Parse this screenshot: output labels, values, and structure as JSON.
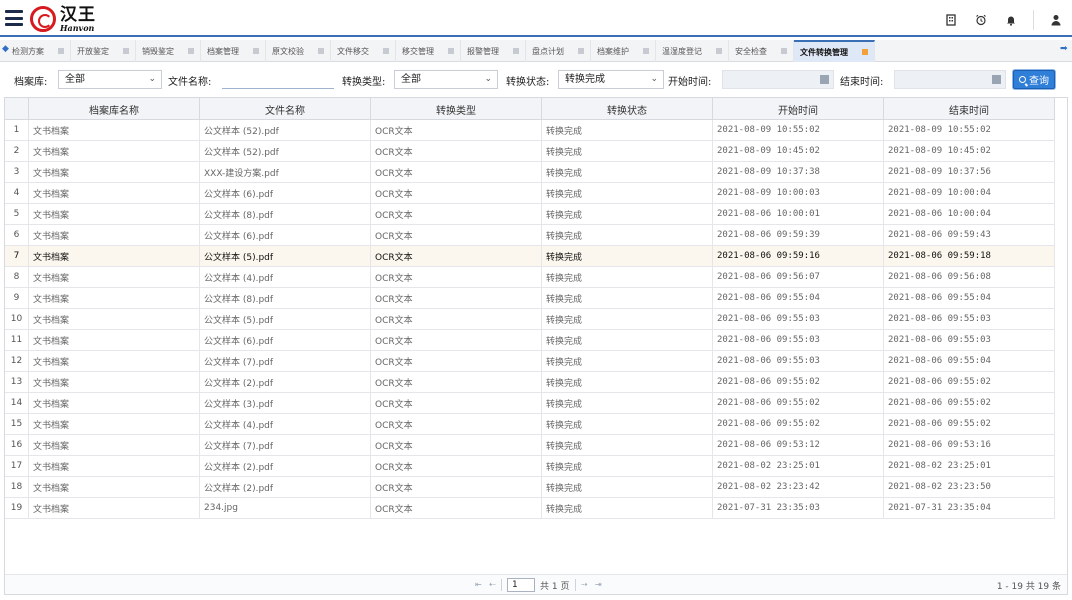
{
  "header": {
    "logo_cn": "汉王",
    "logo_en": "Hanvon"
  },
  "tabs": [
    {
      "label": "检测方案"
    },
    {
      "label": "开放鉴定"
    },
    {
      "label": "销毁鉴定"
    },
    {
      "label": "档案管理"
    },
    {
      "label": "原文校验"
    },
    {
      "label": "文件移交"
    },
    {
      "label": "移交管理"
    },
    {
      "label": "报警管理"
    },
    {
      "label": "盘点计划"
    },
    {
      "label": "档案维护"
    },
    {
      "label": "温湿度登记"
    },
    {
      "label": "安全检查"
    },
    {
      "label": "文件转换管理",
      "active": true
    }
  ],
  "filters": {
    "archive_label": "档案库:",
    "archive_value": "全部",
    "filename_label": "文件名称:",
    "type_label": "转换类型:",
    "type_value": "全部",
    "status_label": "转换状态:",
    "status_value": "转换完成",
    "start_label": "开始时间:",
    "end_label": "结束时间:",
    "search_label": "查询"
  },
  "table": {
    "columns": [
      "档案库名称",
      "文件名称",
      "转换类型",
      "转换状态",
      "开始时间",
      "结束时间"
    ],
    "rows": [
      {
        "n": "1",
        "lib": "文书档案",
        "file": "公文样本 (52).pdf",
        "type": "OCR文本",
        "status": "转换完成",
        "start": "2021-08-09 10:55:02",
        "end": "2021-08-09 10:55:02"
      },
      {
        "n": "2",
        "lib": "文书档案",
        "file": "公文样本 (52).pdf",
        "type": "OCR文本",
        "status": "转换完成",
        "start": "2021-08-09 10:45:02",
        "end": "2021-08-09 10:45:02"
      },
      {
        "n": "3",
        "lib": "文书档案",
        "file": "XXX-建设方案.pdf",
        "type": "OCR文本",
        "status": "转换完成",
        "start": "2021-08-09 10:37:38",
        "end": "2021-08-09 10:37:56"
      },
      {
        "n": "4",
        "lib": "文书档案",
        "file": "公文样本 (6).pdf",
        "type": "OCR文本",
        "status": "转换完成",
        "start": "2021-08-09 10:00:03",
        "end": "2021-08-09 10:00:04"
      },
      {
        "n": "5",
        "lib": "文书档案",
        "file": "公文样本 (8).pdf",
        "type": "OCR文本",
        "status": "转换完成",
        "start": "2021-08-06 10:00:01",
        "end": "2021-08-06 10:00:04"
      },
      {
        "n": "6",
        "lib": "文书档案",
        "file": "公文样本 (6).pdf",
        "type": "OCR文本",
        "status": "转换完成",
        "start": "2021-08-06 09:59:39",
        "end": "2021-08-06 09:59:43"
      },
      {
        "n": "7",
        "lib": "文书档案",
        "file": "公文样本 (5).pdf",
        "type": "OCR文本",
        "status": "转换完成",
        "start": "2021-08-06 09:59:16",
        "end": "2021-08-06 09:59:18",
        "selected": true
      },
      {
        "n": "8",
        "lib": "文书档案",
        "file": "公文样本 (4).pdf",
        "type": "OCR文本",
        "status": "转换完成",
        "start": "2021-08-06 09:56:07",
        "end": "2021-08-06 09:56:08"
      },
      {
        "n": "9",
        "lib": "文书档案",
        "file": "公文样本 (8).pdf",
        "type": "OCR文本",
        "status": "转换完成",
        "start": "2021-08-06 09:55:04",
        "end": "2021-08-06 09:55:04"
      },
      {
        "n": "10",
        "lib": "文书档案",
        "file": "公文样本 (5).pdf",
        "type": "OCR文本",
        "status": "转换完成",
        "start": "2021-08-06 09:55:03",
        "end": "2021-08-06 09:55:03"
      },
      {
        "n": "11",
        "lib": "文书档案",
        "file": "公文样本 (6).pdf",
        "type": "OCR文本",
        "status": "转换完成",
        "start": "2021-08-06 09:55:03",
        "end": "2021-08-06 09:55:03"
      },
      {
        "n": "12",
        "lib": "文书档案",
        "file": "公文样本 (7).pdf",
        "type": "OCR文本",
        "status": "转换完成",
        "start": "2021-08-06 09:55:03",
        "end": "2021-08-06 09:55:04"
      },
      {
        "n": "13",
        "lib": "文书档案",
        "file": "公文样本 (2).pdf",
        "type": "OCR文本",
        "status": "转换完成",
        "start": "2021-08-06 09:55:02",
        "end": "2021-08-06 09:55:02"
      },
      {
        "n": "14",
        "lib": "文书档案",
        "file": "公文样本 (3).pdf",
        "type": "OCR文本",
        "status": "转换完成",
        "start": "2021-08-06 09:55:02",
        "end": "2021-08-06 09:55:02"
      },
      {
        "n": "15",
        "lib": "文书档案",
        "file": "公文样本 (4).pdf",
        "type": "OCR文本",
        "status": "转换完成",
        "start": "2021-08-06 09:55:02",
        "end": "2021-08-06 09:55:02"
      },
      {
        "n": "16",
        "lib": "文书档案",
        "file": "公文样本 (7).pdf",
        "type": "OCR文本",
        "status": "转换完成",
        "start": "2021-08-06 09:53:12",
        "end": "2021-08-06 09:53:16"
      },
      {
        "n": "17",
        "lib": "文书档案",
        "file": "公文样本 (2).pdf",
        "type": "OCR文本",
        "status": "转换完成",
        "start": "2021-08-02 23:25:01",
        "end": "2021-08-02 23:25:01"
      },
      {
        "n": "18",
        "lib": "文书档案",
        "file": "公文样本 (2).pdf",
        "type": "OCR文本",
        "status": "转换完成",
        "start": "2021-08-02 23:23:42",
        "end": "2021-08-02 23:23:50"
      },
      {
        "n": "19",
        "lib": "文书档案",
        "file": "234.jpg",
        "type": "OCR文本",
        "status": "转换完成",
        "start": "2021-07-31 23:35:03",
        "end": "2021-07-31 23:35:04"
      }
    ]
  },
  "pager": {
    "page_value": "1",
    "page_total": "共 1 页",
    "summary": "1 - 19   共 19 条"
  }
}
